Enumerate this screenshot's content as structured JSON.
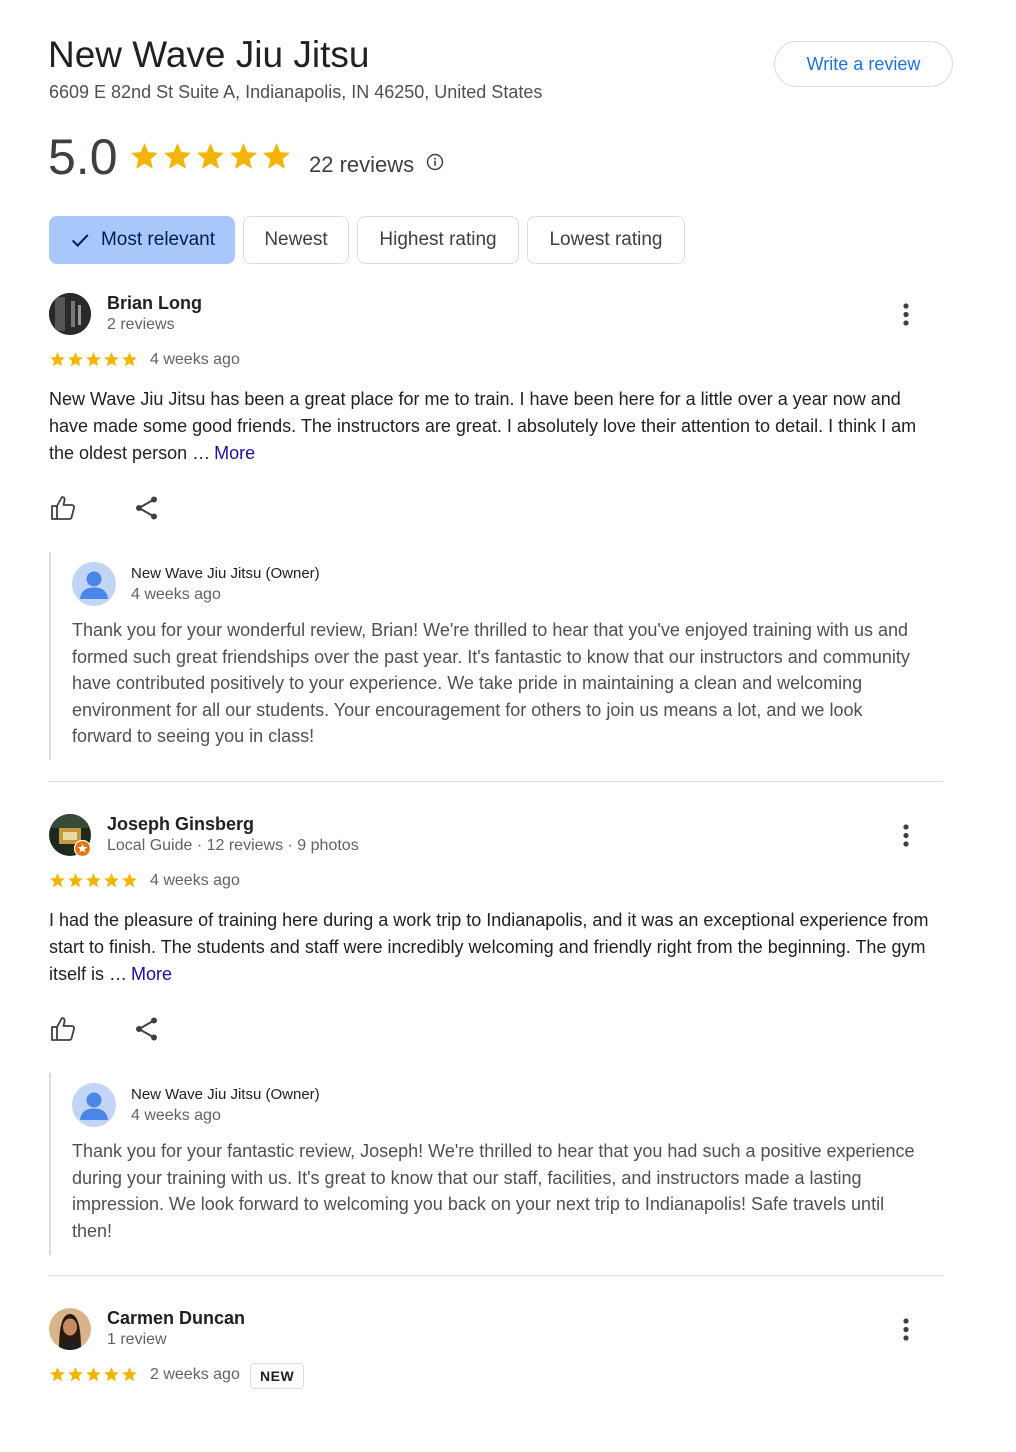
{
  "business": {
    "name": "New Wave Jiu Jitsu",
    "address": "6609 E 82nd St Suite A, Indianapolis, IN 46250, United States",
    "write_review_label": "Write a review",
    "rating": "5.0",
    "rating_stars": 5,
    "reviews_count": "22 reviews"
  },
  "sort_chips": [
    {
      "label": "Most relevant",
      "selected": true
    },
    {
      "label": "Newest",
      "selected": false
    },
    {
      "label": "Highest rating",
      "selected": false
    },
    {
      "label": "Lowest rating",
      "selected": false
    }
  ],
  "colors": {
    "star": "#f4b400",
    "accent": "#1a73e8",
    "chip_selected": "#a8c7fa",
    "more_link": "#1a0dab"
  },
  "reviews": [
    {
      "author": "Brian Long",
      "author_meta": "2 reviews",
      "stars": 5,
      "time": "4 weeks ago",
      "text": "New Wave Jiu Jitsu has been a great place for me to train. I have been here for a little over a year now and have made some good friends. The instructors are great. I absolutely love their attention to detail. I think I am the oldest person …",
      "more_label": "More",
      "owner_reply": {
        "name": "New Wave Jiu Jitsu (Owner)",
        "time": "4 weeks ago",
        "text": "Thank you for your wonderful review, Brian! We're thrilled to hear that you've enjoyed training with us and formed such great friendships over the past year. It's fantastic to know that our instructors and community have contributed positively to your experience. We take pride in maintaining a clean and welcoming environment for all our students. Your encouragement for others to join us means a lot, and we look forward to seeing you in class!"
      }
    },
    {
      "author": "Joseph Ginsberg",
      "author_meta": "Local Guide · 12 reviews · 9 photos",
      "stars": 5,
      "time": "4 weeks ago",
      "text": "I had the pleasure of training here during a work trip to Indianapolis, and it was an exceptional experience from start to finish. The students and staff were incredibly welcoming and friendly right from the beginning. The gym itself is …",
      "more_label": "More",
      "owner_reply": {
        "name": "New Wave Jiu Jitsu (Owner)",
        "time": "4 weeks ago",
        "text": "Thank you for your fantastic review, Joseph! We're thrilled to hear that you had such a positive experience during your training with us. It's great to know that our staff, facilities, and instructors made a lasting impression. We look forward to welcoming you back on your next trip to Indianapolis! Safe travels until then!"
      }
    },
    {
      "author": "Carmen Duncan",
      "author_meta": "1 review",
      "stars": 5,
      "time": "2 weeks ago",
      "badge": "NEW"
    }
  ]
}
